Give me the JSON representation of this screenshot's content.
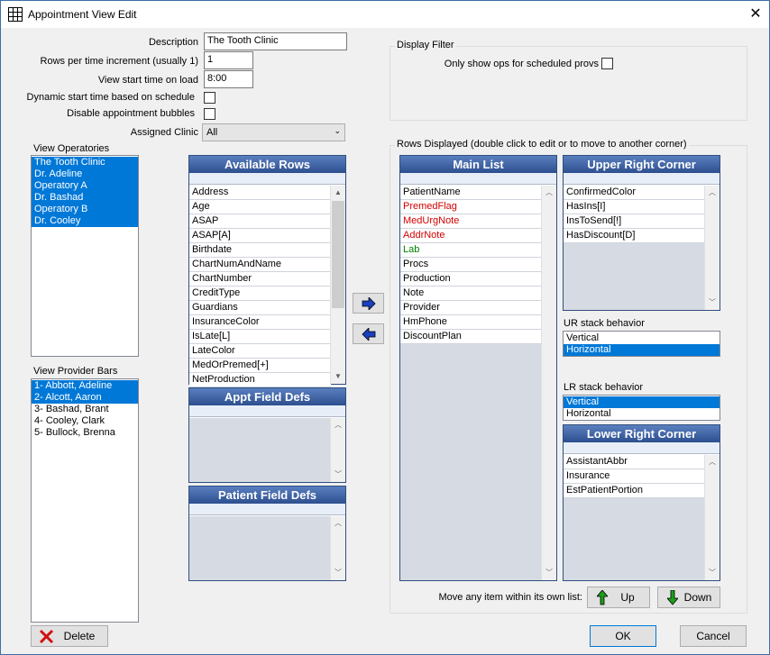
{
  "window": {
    "title": "Appointment View Edit"
  },
  "form": {
    "description_label": "Description",
    "description_value": "The Tooth Clinic",
    "rows_label": "Rows per time increment (usually 1)",
    "rows_value": "1",
    "start_label": "View start time on load",
    "start_value": "8:00",
    "dynamic_label": "Dynamic start time based on schedule",
    "bubbles_label": "Disable appointment bubbles",
    "clinic_label": "Assigned Clinic",
    "clinic_value": "All"
  },
  "filter": {
    "title": "Display Filter",
    "only_ops_label": "Only show ops for scheduled provs"
  },
  "operatories": {
    "label": "View Operatories",
    "items": [
      "The Tooth Clinic",
      "Dr. Adeline",
      "Operatory A",
      "Dr. Bashad",
      "Operatory B",
      "Dr. Cooley"
    ]
  },
  "providers": {
    "label": "View Provider Bars",
    "items": [
      "1- Abbott, Adeline",
      "2- Alcott, Aaron",
      "3- Bashad, Brant",
      "4- Cooley, Clark",
      "5- Bullock, Brenna"
    ]
  },
  "available": {
    "title": "Available Rows",
    "items": [
      "Address",
      "Age",
      "ASAP",
      "ASAP[A]",
      "Birthdate",
      "ChartNumAndName",
      "ChartNumber",
      "CreditType",
      "Guardians",
      "InsuranceColor",
      "IsLate[L]",
      "LateColor",
      "MedOrPremed[+]",
      "NetProduction"
    ]
  },
  "appt_field_defs": {
    "title": "Appt Field Defs"
  },
  "patient_field_defs": {
    "title": "Patient Field Defs"
  },
  "rows_displayed": {
    "title": "Rows Displayed (double click to edit or to move to another corner)"
  },
  "main_list": {
    "title": "Main List",
    "items": [
      {
        "text": "PatientName",
        "color": "#000000"
      },
      {
        "text": "PremedFlag",
        "color": "#d40000"
      },
      {
        "text": "MedUrgNote",
        "color": "#d40000"
      },
      {
        "text": "AddrNote",
        "color": "#d40000"
      },
      {
        "text": "Lab",
        "color": "#008000"
      },
      {
        "text": "Procs",
        "color": "#000000"
      },
      {
        "text": "Production",
        "color": "#000000"
      },
      {
        "text": "Note",
        "color": "#000000"
      },
      {
        "text": "Provider",
        "color": "#000000"
      },
      {
        "text": "HmPhone",
        "color": "#000000"
      },
      {
        "text": "DiscountPlan",
        "color": "#000000"
      }
    ]
  },
  "upper_right": {
    "title": "Upper Right Corner",
    "items": [
      "ConfirmedColor",
      "HasIns[I]",
      "InsToSend[!]",
      "HasDiscount[D]"
    ]
  },
  "ur_stack": {
    "label": "UR stack behavior",
    "items": [
      "Vertical",
      "Horizontal"
    ],
    "selected": 1
  },
  "lr_stack": {
    "label": "LR stack behavior",
    "items": [
      "Vertical",
      "Horizontal"
    ],
    "selected": 0
  },
  "lower_right": {
    "title": "Lower Right Corner",
    "items": [
      "AssistantAbbr",
      "Insurance",
      "EstPatientPortion"
    ]
  },
  "move": {
    "label": "Move any item within its own list:",
    "up": "Up",
    "down": "Down"
  },
  "buttons": {
    "delete": "Delete",
    "ok": "OK",
    "cancel": "Cancel"
  },
  "colors": {
    "accent": "#0078d7",
    "grid_header": "#3a5fa0"
  }
}
